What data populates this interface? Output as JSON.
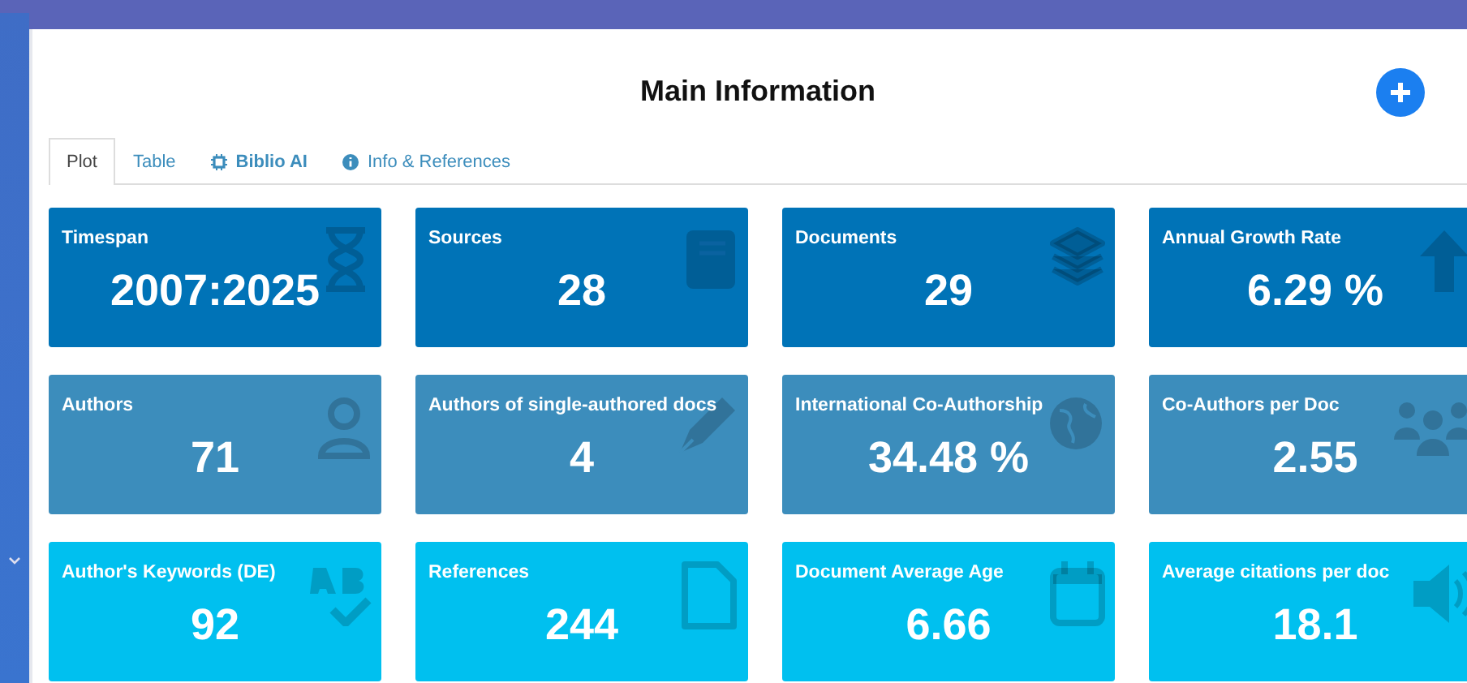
{
  "title": "Main Information",
  "tabs": [
    {
      "label": "Plot",
      "selected": true
    },
    {
      "label": "Table",
      "selected": false
    },
    {
      "label": "Biblio AI",
      "selected": false
    },
    {
      "label": "Info & References",
      "selected": false
    }
  ],
  "cards": [
    {
      "label": "Timespan",
      "value": "2007:2025",
      "color": "#0073b7"
    },
    {
      "label": "Sources",
      "value": "28",
      "color": "#0073b7"
    },
    {
      "label": "Documents",
      "value": "29",
      "color": "#0073b7"
    },
    {
      "label": "Annual Growth Rate",
      "value": "6.29 %",
      "color": "#0073b7"
    },
    {
      "label": "Authors",
      "value": "71",
      "color": "#3c8dbc"
    },
    {
      "label": "Authors of single-authored docs",
      "value": "4",
      "color": "#3c8dbc"
    },
    {
      "label": "International Co-Authorship",
      "value": "34.48 %",
      "color": "#3c8dbc"
    },
    {
      "label": "Co-Authors per Doc",
      "value": "2.55",
      "color": "#3c8dbc"
    },
    {
      "label": "Author's Keywords (DE)",
      "value": "92",
      "color": "#00c0ef"
    },
    {
      "label": "References",
      "value": "244",
      "color": "#00c0ef"
    },
    {
      "label": "Document Average Age",
      "value": "6.66",
      "color": "#00c0ef"
    },
    {
      "label": "Average citations per doc",
      "value": "18.1",
      "color": "#00c0ef"
    }
  ]
}
